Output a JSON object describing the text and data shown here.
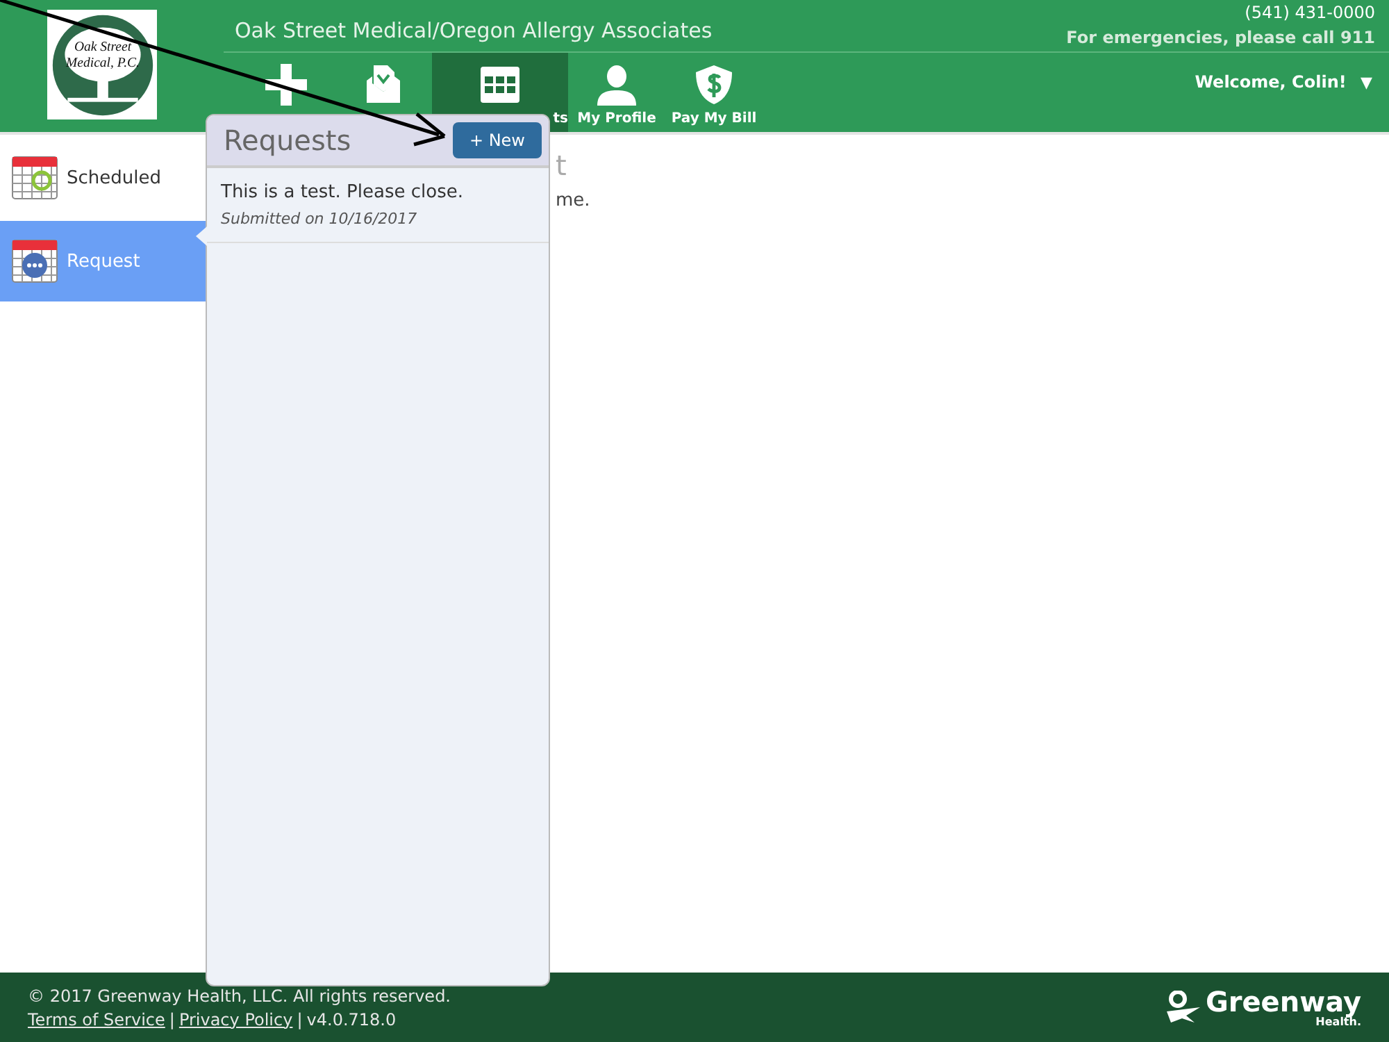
{
  "header": {
    "practice_name": "Oak Street Medical/Oregon Allergy Associates",
    "phone": "(541) 431-0000",
    "emergency_note": "For emergencies, please call 911",
    "welcome": "Welcome, Colin!",
    "welcome_caret": "▼",
    "logo_text": [
      "Oak Street",
      "Medical, P.C."
    ]
  },
  "nav": [
    {
      "selected": false
    },
    {
      "selected": false
    },
    {
      "label": "ts",
      "selected": true
    },
    {
      "label": "My Profile",
      "selected": false
    },
    {
      "label": "Pay My Bill",
      "selected": false
    }
  ],
  "sidebar": {
    "items": [
      {
        "label": "Scheduled",
        "selected": false
      },
      {
        "label": "Request",
        "selected": true
      }
    ]
  },
  "main": {
    "heading_fragment": "t",
    "message_fragment": "me."
  },
  "popover": {
    "title": "Requests",
    "new_button": "+ New",
    "requests": [
      {
        "subject": "This is a test. Please close.",
        "submitted": "Submitted on 10/16/2017"
      }
    ]
  },
  "footer": {
    "copyright": "© 2017 Greenway Health, LLC. All rights reserved.",
    "links": [
      "Terms of Service",
      "|",
      "Privacy Policy",
      "|"
    ],
    "version": "v4.0.718.0",
    "brand": "Greenway",
    "brand_sub": "Health."
  }
}
